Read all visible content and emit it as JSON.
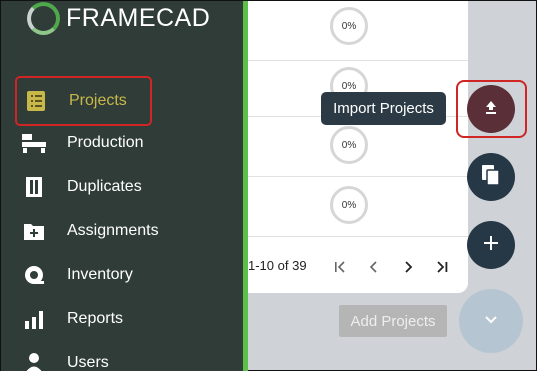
{
  "brand": {
    "name": "FRAMECAD"
  },
  "sidebar": {
    "items": [
      {
        "label": "Projects",
        "icon": "projects-icon",
        "active": true
      },
      {
        "label": "Production",
        "icon": "production-icon"
      },
      {
        "label": "Duplicates",
        "icon": "duplicates-icon"
      },
      {
        "label": "Assignments",
        "icon": "assignments-icon"
      },
      {
        "label": "Inventory",
        "icon": "inventory-icon"
      },
      {
        "label": "Reports",
        "icon": "reports-icon"
      },
      {
        "label": "Users",
        "icon": "users-icon"
      }
    ]
  },
  "table": {
    "rows": [
      {
        "progress": "0%"
      },
      {
        "progress": "0%"
      },
      {
        "progress": "0%"
      },
      {
        "progress": "0%"
      }
    ],
    "pagination": {
      "range": "1-10 of 39"
    }
  },
  "tooltip": {
    "text": "Import Projects"
  },
  "actions": {
    "add_projects_label": "Add Projects"
  },
  "colors": {
    "sidebar_bg": "#2f3c38",
    "accent_green": "#5bbf4a",
    "active_label": "#c8b84a",
    "highlight_red": "#d02525",
    "fab_dark": "#263746",
    "fab_import": "#5a2f37"
  }
}
